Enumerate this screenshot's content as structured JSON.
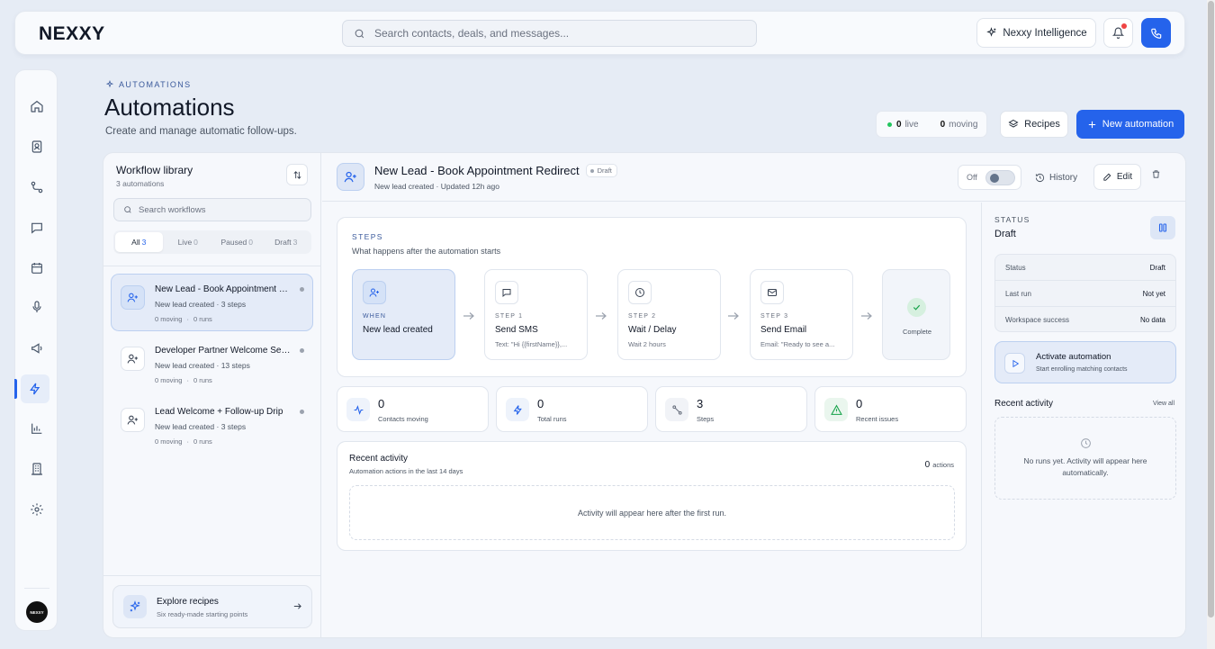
{
  "topbar": {
    "logo": "NEXXY",
    "search_placeholder": "Search contacts, deals, and messages...",
    "intelligence_label": "Nexxy Intelligence",
    "notifications_icon": "bell-icon",
    "phone_icon": "phone-icon",
    "accent": "#2563eb"
  },
  "sidebar": {
    "items": [
      {
        "icon": "home-icon"
      },
      {
        "icon": "contacts-icon"
      },
      {
        "icon": "pipeline-icon"
      },
      {
        "icon": "messages-icon"
      },
      {
        "icon": "calendar-icon"
      },
      {
        "icon": "microphone-icon"
      },
      {
        "icon": "megaphone-icon"
      },
      {
        "icon": "automations-icon",
        "active": true
      },
      {
        "icon": "reports-icon"
      },
      {
        "icon": "building-icon"
      },
      {
        "icon": "settings-icon"
      }
    ],
    "avatar_text": "NEXXY"
  },
  "page": {
    "breadcrumb": "AUTOMATIONS",
    "title": "Automations",
    "subtitle": "Create and manage automatic follow-ups.",
    "live_count": "0",
    "live_label": "live",
    "moving_count": "0",
    "moving_label": "moving",
    "recipes_label": "Recipes",
    "new_label": "New automation"
  },
  "library": {
    "title": "Workflow library",
    "count_text": "3 automations",
    "search_placeholder": "Search workflows",
    "filters": [
      {
        "label": "All",
        "count": "3",
        "active": true
      },
      {
        "label": "Live",
        "count": "0"
      },
      {
        "label": "Paused",
        "count": "0"
      },
      {
        "label": "Draft",
        "count": "3"
      }
    ],
    "workflows": [
      {
        "title": "New Lead - Book Appointment Redirect",
        "subtitle": "New lead created · 3 steps",
        "moving": "0 moving",
        "runs": "0 runs",
        "selected": true
      },
      {
        "title": "Developer Partner Welcome Sequence",
        "subtitle": "New lead created · 13 steps",
        "moving": "0 moving",
        "runs": "0 runs"
      },
      {
        "title": "Lead Welcome + Follow-up Drip",
        "subtitle": "New lead created · 3 steps",
        "moving": "0 moving",
        "runs": "0 runs"
      }
    ],
    "explore_title": "Explore recipes",
    "explore_sub": "Six ready-made starting points"
  },
  "detail": {
    "title": "New Lead - Book Appointment Redirect",
    "badge": "Draft",
    "subtitle": "New lead created · Updated 12h ago",
    "toggle_label": "Off",
    "toggle_on": false,
    "history_label": "History",
    "edit_label": "Edit",
    "steps_label": "STEPS",
    "steps_sub": "What happens after the automation starts",
    "cards": [
      {
        "kicker": "WHEN",
        "name": "New lead created",
        "desc": "",
        "icon": "user-plus-icon"
      },
      {
        "kicker": "STEP 1",
        "name": "Send SMS",
        "desc": "Text: \"Hi {{firstName}},...",
        "icon": "message-icon"
      },
      {
        "kicker": "STEP 2",
        "name": "Wait / Delay",
        "desc": "Wait 2 hours",
        "icon": "clock-icon"
      },
      {
        "kicker": "STEP 3",
        "name": "Send Email",
        "desc": "Email: \"Ready to see a...",
        "icon": "mail-icon"
      }
    ],
    "complete_label": "Complete",
    "stats": [
      {
        "value": "0",
        "label": "Contacts moving",
        "icon": "activity-icon"
      },
      {
        "value": "0",
        "label": "Total runs",
        "icon": "bolt-icon"
      },
      {
        "value": "3",
        "label": "Steps",
        "icon": "route-icon"
      },
      {
        "value": "0",
        "label": "Recent issues",
        "icon": "alert-icon"
      }
    ],
    "recent_title": "Recent activity",
    "recent_sub": "Automation actions in the last 14 days",
    "recent_count": "0",
    "recent_count_label": "actions",
    "recent_empty": "Activity will appear here after the first run."
  },
  "status_panel": {
    "label": "STATUS",
    "value": "Draft",
    "rows": [
      {
        "k": "Status",
        "v": "Draft"
      },
      {
        "k": "Last run",
        "v": "Not yet"
      },
      {
        "k": "Workspace success",
        "v": "No data"
      }
    ],
    "activate_title": "Activate automation",
    "activate_sub": "Start enrolling matching contacts",
    "recent_label": "Recent activity",
    "view_all": "View all",
    "empty_text": "No runs yet. Activity will appear here automatically."
  }
}
